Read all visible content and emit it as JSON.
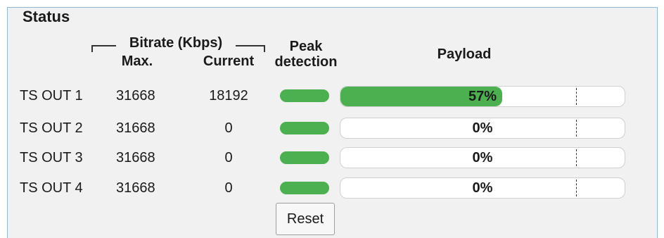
{
  "title": "Status",
  "headers": {
    "bitrate": "Bitrate (Kbps)",
    "max": "Max.",
    "current": "Current",
    "peak_line1": "Peak",
    "peak_line2": "detection",
    "payload": "Payload"
  },
  "rows": [
    {
      "label": "TS OUT 1",
      "max": "31668",
      "current": "18192",
      "payload_text": "57%",
      "payload_percent": 57
    },
    {
      "label": "TS OUT 2",
      "max": "31668",
      "current": "0",
      "payload_text": "0%",
      "payload_percent": 0
    },
    {
      "label": "TS OUT 3",
      "max": "31668",
      "current": "0",
      "payload_text": "0%",
      "payload_percent": 0
    },
    {
      "label": "TS OUT 4",
      "max": "31668",
      "current": "0",
      "payload_text": "0%",
      "payload_percent": 0
    }
  ],
  "reset_label": "Reset",
  "colors": {
    "indicator_green": "#4caf50",
    "panel_bg": "#f1f1f1",
    "panel_border": "#8fb9d6"
  }
}
